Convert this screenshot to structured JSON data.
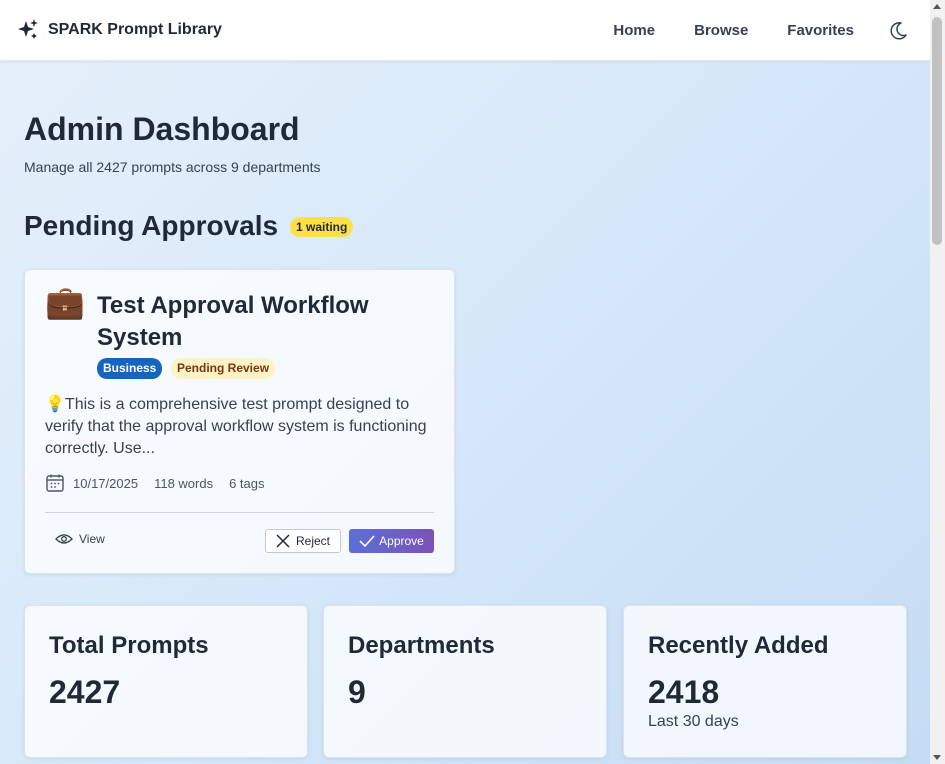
{
  "navbar": {
    "brand": "SPARK Prompt Library",
    "links": [
      "Home",
      "Browse",
      "Favorites"
    ],
    "brand_icon": "sparkles-icon",
    "theme_icon": "moon-icon"
  },
  "header": {
    "title": "Admin Dashboard",
    "subtitle": "Manage all 2427 prompts across 9 departments"
  },
  "pending": {
    "title": "Pending Approvals",
    "badge": "1 waiting",
    "card": {
      "emoji": "💼",
      "title": "Test Approval Workflow System",
      "department": "Business",
      "status": "Pending Review",
      "description": "💡This is a comprehensive test prompt designed to verify that the approval workflow system is functioning correctly. Use...",
      "date": "10/17/2025",
      "words": "118 words",
      "tags": "6 tags",
      "view_label": "View",
      "reject_label": "Reject",
      "approve_label": "Approve"
    }
  },
  "stats": [
    {
      "label": "Total Prompts",
      "value": "2427",
      "note": ""
    },
    {
      "label": "Departments",
      "value": "9",
      "note": ""
    },
    {
      "label": "Recently Added",
      "value": "2418",
      "note": "Last 30 days"
    }
  ],
  "colors": {
    "accent_start": "#5b6fd8",
    "accent_end": "#7b52b7",
    "business_tag": "#1565c0",
    "waiting_badge": "#fde047",
    "pending_tag": "#fef3c7"
  }
}
